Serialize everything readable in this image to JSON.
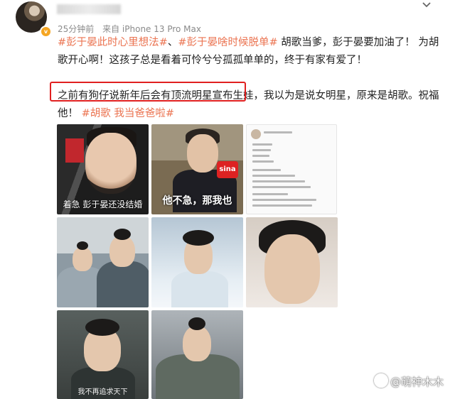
{
  "post": {
    "time": "25分钟前",
    "source": "来自 iPhone 13 Pro Max",
    "tags_line1": [
      "#彭于晏此时心里想法#",
      "#彭于晏啥时候脱单#"
    ],
    "separator": "、",
    "text1": "胡歌当爹，彭于晏要加油了！ 为胡歌开心啊！这孩子总是看着可怜兮兮孤孤单单的，终于有家有爱了！",
    "highlighted": "之前有狗仔说新年后会有顶流明星宣布生娃",
    "text2": "，我以为是说女明星，原来是胡歌。祝福他！",
    "tags_line2": [
      "#胡歌 我当爸爸啦#"
    ]
  },
  "photos": {
    "p1_caption": "着急 彭于晏还没结婚",
    "p2_caption": "他不急，那我也",
    "p2_mic": "sina",
    "p7_caption": "我不再追求天下"
  },
  "watermark": "@萌神木木",
  "colors": {
    "tag": "#eb7350",
    "highlight_border": "#e02020",
    "meta": "#8a8a8a"
  }
}
